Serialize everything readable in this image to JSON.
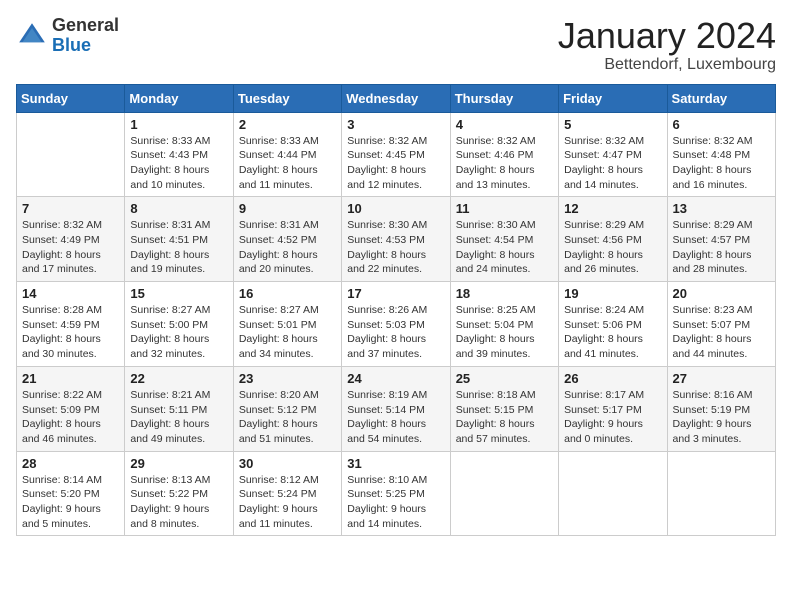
{
  "header": {
    "logo_general": "General",
    "logo_blue": "Blue",
    "month_title": "January 2024",
    "location": "Bettendorf, Luxembourg"
  },
  "weekdays": [
    "Sunday",
    "Monday",
    "Tuesday",
    "Wednesday",
    "Thursday",
    "Friday",
    "Saturday"
  ],
  "weeks": [
    [
      {
        "day": "",
        "sunrise": "",
        "sunset": "",
        "daylight": ""
      },
      {
        "day": "1",
        "sunrise": "Sunrise: 8:33 AM",
        "sunset": "Sunset: 4:43 PM",
        "daylight": "Daylight: 8 hours and 10 minutes."
      },
      {
        "day": "2",
        "sunrise": "Sunrise: 8:33 AM",
        "sunset": "Sunset: 4:44 PM",
        "daylight": "Daylight: 8 hours and 11 minutes."
      },
      {
        "day": "3",
        "sunrise": "Sunrise: 8:32 AM",
        "sunset": "Sunset: 4:45 PM",
        "daylight": "Daylight: 8 hours and 12 minutes."
      },
      {
        "day": "4",
        "sunrise": "Sunrise: 8:32 AM",
        "sunset": "Sunset: 4:46 PM",
        "daylight": "Daylight: 8 hours and 13 minutes."
      },
      {
        "day": "5",
        "sunrise": "Sunrise: 8:32 AM",
        "sunset": "Sunset: 4:47 PM",
        "daylight": "Daylight: 8 hours and 14 minutes."
      },
      {
        "day": "6",
        "sunrise": "Sunrise: 8:32 AM",
        "sunset": "Sunset: 4:48 PM",
        "daylight": "Daylight: 8 hours and 16 minutes."
      }
    ],
    [
      {
        "day": "7",
        "sunrise": "Sunrise: 8:32 AM",
        "sunset": "Sunset: 4:49 PM",
        "daylight": "Daylight: 8 hours and 17 minutes."
      },
      {
        "day": "8",
        "sunrise": "Sunrise: 8:31 AM",
        "sunset": "Sunset: 4:51 PM",
        "daylight": "Daylight: 8 hours and 19 minutes."
      },
      {
        "day": "9",
        "sunrise": "Sunrise: 8:31 AM",
        "sunset": "Sunset: 4:52 PM",
        "daylight": "Daylight: 8 hours and 20 minutes."
      },
      {
        "day": "10",
        "sunrise": "Sunrise: 8:30 AM",
        "sunset": "Sunset: 4:53 PM",
        "daylight": "Daylight: 8 hours and 22 minutes."
      },
      {
        "day": "11",
        "sunrise": "Sunrise: 8:30 AM",
        "sunset": "Sunset: 4:54 PM",
        "daylight": "Daylight: 8 hours and 24 minutes."
      },
      {
        "day": "12",
        "sunrise": "Sunrise: 8:29 AM",
        "sunset": "Sunset: 4:56 PM",
        "daylight": "Daylight: 8 hours and 26 minutes."
      },
      {
        "day": "13",
        "sunrise": "Sunrise: 8:29 AM",
        "sunset": "Sunset: 4:57 PM",
        "daylight": "Daylight: 8 hours and 28 minutes."
      }
    ],
    [
      {
        "day": "14",
        "sunrise": "Sunrise: 8:28 AM",
        "sunset": "Sunset: 4:59 PM",
        "daylight": "Daylight: 8 hours and 30 minutes."
      },
      {
        "day": "15",
        "sunrise": "Sunrise: 8:27 AM",
        "sunset": "Sunset: 5:00 PM",
        "daylight": "Daylight: 8 hours and 32 minutes."
      },
      {
        "day": "16",
        "sunrise": "Sunrise: 8:27 AM",
        "sunset": "Sunset: 5:01 PM",
        "daylight": "Daylight: 8 hours and 34 minutes."
      },
      {
        "day": "17",
        "sunrise": "Sunrise: 8:26 AM",
        "sunset": "Sunset: 5:03 PM",
        "daylight": "Daylight: 8 hours and 37 minutes."
      },
      {
        "day": "18",
        "sunrise": "Sunrise: 8:25 AM",
        "sunset": "Sunset: 5:04 PM",
        "daylight": "Daylight: 8 hours and 39 minutes."
      },
      {
        "day": "19",
        "sunrise": "Sunrise: 8:24 AM",
        "sunset": "Sunset: 5:06 PM",
        "daylight": "Daylight: 8 hours and 41 minutes."
      },
      {
        "day": "20",
        "sunrise": "Sunrise: 8:23 AM",
        "sunset": "Sunset: 5:07 PM",
        "daylight": "Daylight: 8 hours and 44 minutes."
      }
    ],
    [
      {
        "day": "21",
        "sunrise": "Sunrise: 8:22 AM",
        "sunset": "Sunset: 5:09 PM",
        "daylight": "Daylight: 8 hours and 46 minutes."
      },
      {
        "day": "22",
        "sunrise": "Sunrise: 8:21 AM",
        "sunset": "Sunset: 5:11 PM",
        "daylight": "Daylight: 8 hours and 49 minutes."
      },
      {
        "day": "23",
        "sunrise": "Sunrise: 8:20 AM",
        "sunset": "Sunset: 5:12 PM",
        "daylight": "Daylight: 8 hours and 51 minutes."
      },
      {
        "day": "24",
        "sunrise": "Sunrise: 8:19 AM",
        "sunset": "Sunset: 5:14 PM",
        "daylight": "Daylight: 8 hours and 54 minutes."
      },
      {
        "day": "25",
        "sunrise": "Sunrise: 8:18 AM",
        "sunset": "Sunset: 5:15 PM",
        "daylight": "Daylight: 8 hours and 57 minutes."
      },
      {
        "day": "26",
        "sunrise": "Sunrise: 8:17 AM",
        "sunset": "Sunset: 5:17 PM",
        "daylight": "Daylight: 9 hours and 0 minutes."
      },
      {
        "day": "27",
        "sunrise": "Sunrise: 8:16 AM",
        "sunset": "Sunset: 5:19 PM",
        "daylight": "Daylight: 9 hours and 3 minutes."
      }
    ],
    [
      {
        "day": "28",
        "sunrise": "Sunrise: 8:14 AM",
        "sunset": "Sunset: 5:20 PM",
        "daylight": "Daylight: 9 hours and 5 minutes."
      },
      {
        "day": "29",
        "sunrise": "Sunrise: 8:13 AM",
        "sunset": "Sunset: 5:22 PM",
        "daylight": "Daylight: 9 hours and 8 minutes."
      },
      {
        "day": "30",
        "sunrise": "Sunrise: 8:12 AM",
        "sunset": "Sunset: 5:24 PM",
        "daylight": "Daylight: 9 hours and 11 minutes."
      },
      {
        "day": "31",
        "sunrise": "Sunrise: 8:10 AM",
        "sunset": "Sunset: 5:25 PM",
        "daylight": "Daylight: 9 hours and 14 minutes."
      },
      {
        "day": "",
        "sunrise": "",
        "sunset": "",
        "daylight": ""
      },
      {
        "day": "",
        "sunrise": "",
        "sunset": "",
        "daylight": ""
      },
      {
        "day": "",
        "sunrise": "",
        "sunset": "",
        "daylight": ""
      }
    ]
  ]
}
